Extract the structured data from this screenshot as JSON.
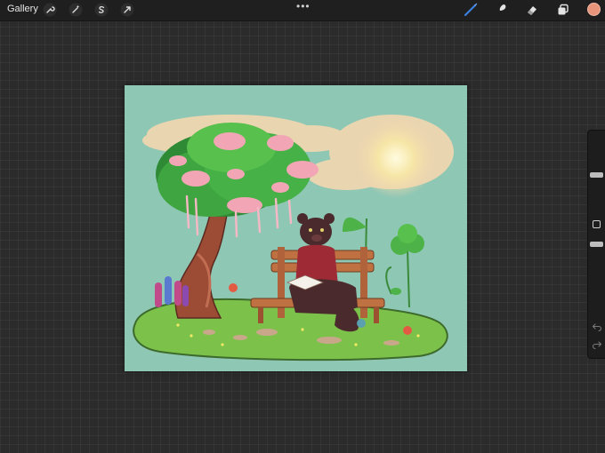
{
  "toolbar": {
    "gallery_label": "Gallery",
    "left_tools": [
      "wrench-icon",
      "magic-wand-icon",
      "selection-s-icon",
      "transform-arrow-icon"
    ],
    "more_label": "•••",
    "right_tools": [
      "brush-icon",
      "smudge-icon",
      "eraser-icon",
      "layers-icon"
    ],
    "brush_active_color": "#3d7fe0",
    "current_color": "#e8957b"
  },
  "sidebar": {
    "brush_size_level": 0.35,
    "opacity_level": 0.5
  },
  "artwork": {
    "palette": {
      "background": "#8fc7b5",
      "cloud": "#f3d7b0",
      "sun": "#fff4b8",
      "ground": "#7cc24a",
      "tree_leaves": "#3fa540",
      "blossom": "#f2a6b5",
      "trunk": "#9c4b34",
      "bench": "#c07141",
      "character": "#4a2a2c",
      "shirt": "#9e2a35"
    }
  }
}
